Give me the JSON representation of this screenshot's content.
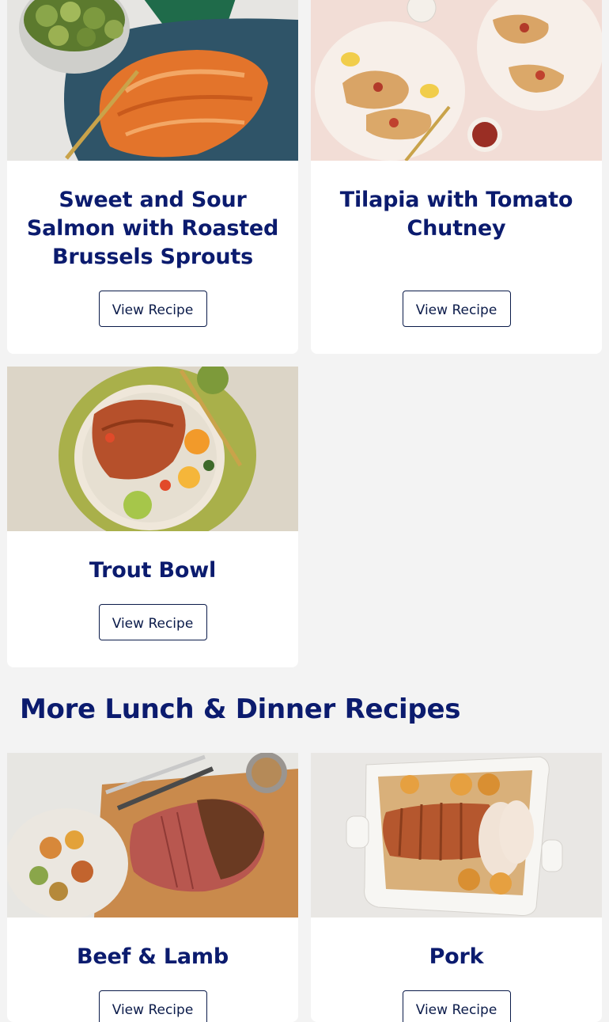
{
  "recipes": [
    {
      "title": "Sweet and Sour Salmon with Roasted Brussels Sprouts",
      "button": "View Recipe"
    },
    {
      "title": "Tilapia with Tomato Chutney",
      "button": "View Recipe"
    },
    {
      "title": "Trout Bowl",
      "button": "View Recipe"
    }
  ],
  "section": {
    "heading": "More Lunch & Dinner Recipes"
  },
  "more_recipes": [
    {
      "title": "Beef & Lamb",
      "button": "View Recipe"
    },
    {
      "title": "Pork",
      "button": "View Recipe"
    }
  ],
  "colors": {
    "heading": "#0b1b6e",
    "page_background": "#f3f3f3",
    "card_background": "#ffffff",
    "button_border": "#0b1b4a"
  }
}
